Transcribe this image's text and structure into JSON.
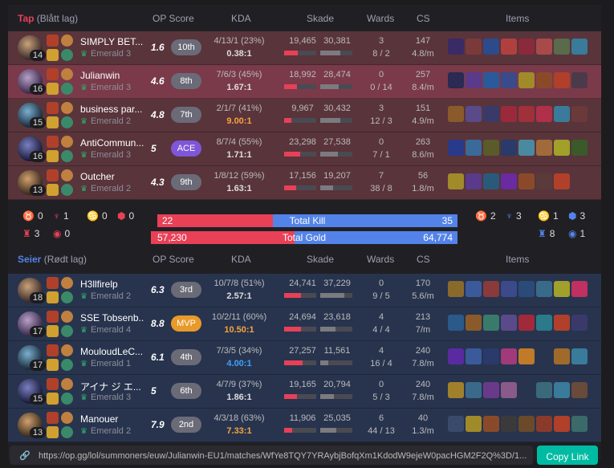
{
  "loss_team": {
    "title": "Tap",
    "side": "(Blått lag)",
    "headers": {
      "ops": "OP Score",
      "kda": "KDA",
      "dmg": "Skade",
      "wards": "Wards",
      "cs": "CS",
      "items": "Items"
    },
    "players": [
      {
        "level": "14",
        "name": "SIMPLY BET...",
        "rank": "Emerald 3",
        "ops": "1.6",
        "badge": "10th",
        "kda_ratio": "4/13/1 (23%)",
        "kda": "0.38:1",
        "dmg": "19,465",
        "taken": "30,381",
        "dealt_pct": 0.42,
        "taken_pct": 0.62,
        "wards": "3",
        "wards2": "8 / 2",
        "cs": "147",
        "csm": "4.8/m"
      },
      {
        "level": "16",
        "name": "Julianwin",
        "rank": "Emerald 3",
        "ops": "4.6",
        "badge": "8th",
        "kda_ratio": "7/6/3 (45%)",
        "kda": "1.67:1",
        "dmg": "18,992",
        "taken": "28,474",
        "dealt_pct": 0.41,
        "taken_pct": 0.58,
        "wards": "0",
        "wards2": "0 / 14",
        "cs": "257",
        "csm": "8.4/m"
      },
      {
        "level": "15",
        "name": "business par...",
        "rank": "Emerald 2",
        "ops": "4.8",
        "badge": "7th",
        "kda_ratio": "2/1/7 (41%)",
        "kda": "9.00:1",
        "dmg": "9,967",
        "taken": "30,432",
        "dealt_pct": 0.22,
        "taken_pct": 0.62,
        "wards": "3",
        "wards2": "12 / 3",
        "cs": "151",
        "csm": "4.9/m"
      },
      {
        "level": "16",
        "name": "AntiCommun...",
        "rank": "Emerald 3",
        "ops": "5",
        "badge": "ACE",
        "kda_ratio": "8/7/4 (55%)",
        "kda": "1.71:1",
        "dmg": "23,298",
        "taken": "27,538",
        "dealt_pct": 0.5,
        "taken_pct": 0.56,
        "wards": "0",
        "wards2": "7 / 1",
        "cs": "263",
        "csm": "8.6/m"
      },
      {
        "level": "13",
        "name": "Outcher",
        "rank": "Emerald 2",
        "ops": "4.3",
        "badge": "9th",
        "kda_ratio": "1/8/12 (59%)",
        "kda": "1.63:1",
        "dmg": "17,156",
        "taken": "19,207",
        "dealt_pct": 0.37,
        "taken_pct": 0.39,
        "wards": "7",
        "wards2": "38 / 8",
        "cs": "56",
        "csm": "1.8/m"
      }
    ]
  },
  "win_team": {
    "title": "Seier",
    "side": "(Rødt lag)",
    "headers": {
      "ops": "OP Score",
      "kda": "KDA",
      "dmg": "Skade",
      "wards": "Wards",
      "cs": "CS",
      "items": "Items"
    },
    "players": [
      {
        "level": "18",
        "name": "H3llfirelp",
        "rank": "Emerald 2",
        "ops": "6.3",
        "badge": "3rd",
        "kda_ratio": "10/7/8 (51%)",
        "kda": "2.57:1",
        "dmg": "24,741",
        "taken": "37,229",
        "dealt_pct": 0.53,
        "taken_pct": 0.76,
        "wards": "0",
        "wards2": "9 / 5",
        "cs": "170",
        "csm": "5.6/m"
      },
      {
        "level": "17",
        "name": "SSE Tobsenb...",
        "rank": "Emerald 4",
        "ops": "8.8",
        "badge": "MVP",
        "kda_ratio": "10/2/11 (60%)",
        "kda": "10.50:1",
        "dmg": "24,694",
        "taken": "23,618",
        "dealt_pct": 0.53,
        "taken_pct": 0.48,
        "wards": "4",
        "wards2": "4 / 4",
        "cs": "213",
        "csm": "7/m"
      },
      {
        "level": "17",
        "name": "MouloudLeC...",
        "rank": "Emerald 1",
        "ops": "6.1",
        "badge": "4th",
        "kda_ratio": "7/3/5 (34%)",
        "kda": "4.00:1",
        "dmg": "27,257",
        "taken": "11,561",
        "dealt_pct": 0.58,
        "taken_pct": 0.24,
        "wards": "4",
        "wards2": "16 / 4",
        "cs": "240",
        "csm": "7.8/m"
      },
      {
        "level": "15",
        "name": "アイナ ジ エ...",
        "rank": "Emerald 3",
        "ops": "5",
        "badge": "6th",
        "kda_ratio": "4/7/9 (37%)",
        "kda": "1.86:1",
        "dmg": "19,165",
        "taken": "20,794",
        "dealt_pct": 0.41,
        "taken_pct": 0.42,
        "wards": "0",
        "wards2": "5 / 3",
        "cs": "240",
        "csm": "7.8/m"
      },
      {
        "level": "13",
        "name": "Manouer",
        "rank": "Emerald 2",
        "ops": "7.9",
        "badge": "2nd",
        "kda_ratio": "4/3/18 (63%)",
        "kda": "7.33:1",
        "dmg": "11,906",
        "taken": "25,035",
        "dealt_pct": 0.26,
        "taken_pct": 0.51,
        "wards": "6",
        "wards2": "44 / 13",
        "cs": "40",
        "csm": "1.3/m"
      }
    ]
  },
  "summary": {
    "red_obj": {
      "baron": "0",
      "herald": "1",
      "towers": "0",
      "inhib": "0",
      "drake": "3",
      "grubs": "0"
    },
    "blue_obj": {
      "baron": "2",
      "herald": "3",
      "towers": "1",
      "inhib": "3",
      "drake": "8",
      "grubs": "1"
    },
    "kill_left": "22",
    "kill_right": "35",
    "kill_label": "Total Kill",
    "kill_left_frac": 0.386,
    "gold_left": "57,230",
    "gold_right": "64,774",
    "gold_label": "Total Gold",
    "gold_left_frac": 0.469
  },
  "footer": {
    "url": "https://op.gg/lol/summoners/euw/Julianwin-EU1/matches/WfYe8TQY7YRAybjBofqXm1KdodW9ejeW0pacHGM2F2Q%3D/1...",
    "copy": "Copy Link"
  },
  "colors": {
    "loss_bg": "#59343b",
    "win_bg": "#28344e",
    "red": "#e84057",
    "blue": "#5383e8",
    "teal": "#00bba3"
  }
}
